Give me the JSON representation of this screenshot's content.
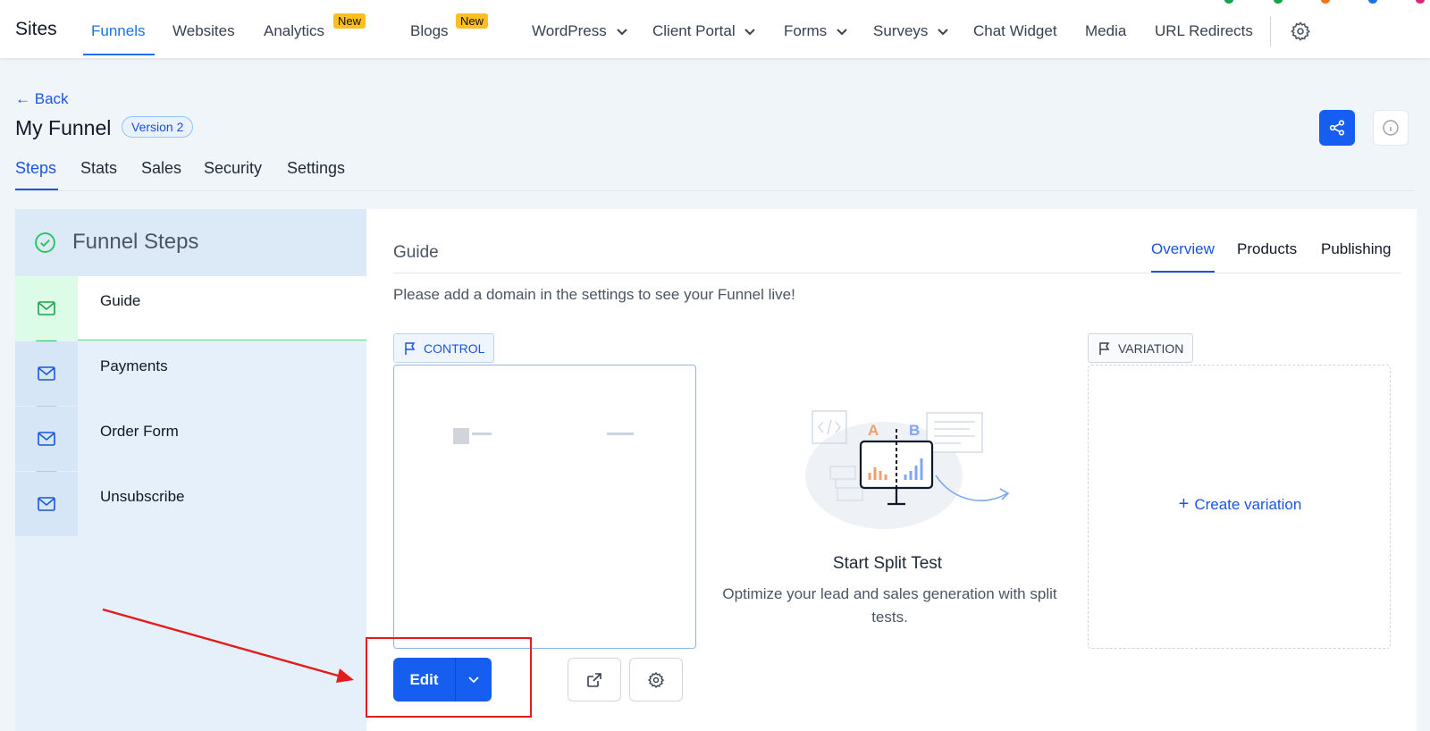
{
  "topnav": {
    "brand": "Sites",
    "items": [
      {
        "label": "Funnels"
      },
      {
        "label": "Websites"
      },
      {
        "label": "Analytics",
        "badge": "New"
      },
      {
        "label": "Blogs",
        "badge": "New"
      },
      {
        "label": "WordPress"
      },
      {
        "label": "Client Portal"
      },
      {
        "label": "Forms"
      },
      {
        "label": "Surveys"
      },
      {
        "label": "Chat Widget"
      },
      {
        "label": "Media"
      },
      {
        "label": "URL Redirects"
      }
    ]
  },
  "header": {
    "back": "Back",
    "title": "My Funnel",
    "version": "Version 2",
    "tabs": [
      "Steps",
      "Stats",
      "Sales",
      "Security",
      "Settings"
    ]
  },
  "sidebar": {
    "title": "Funnel Steps",
    "steps": [
      {
        "label": "Guide"
      },
      {
        "label": "Payments"
      },
      {
        "label": "Order Form"
      },
      {
        "label": "Unsubscribe"
      }
    ]
  },
  "main": {
    "title": "Guide",
    "tabs": [
      "Overview",
      "Products",
      "Publishing"
    ],
    "note": "Please add a domain in the settings to see your Funnel live!",
    "control_tag": "CONTROL",
    "variation_tag": "VARIATION",
    "edit_label": "Edit",
    "split_title": "Start Split Test",
    "split_desc": "Optimize your lead and sales generation with split tests.",
    "create_variation": "Create variation"
  },
  "colors": {
    "accent": "#155eef",
    "link": "#1a56db",
    "badge": "#fbbf24",
    "success": "#22c55e",
    "annotation": "#e11d1d"
  }
}
